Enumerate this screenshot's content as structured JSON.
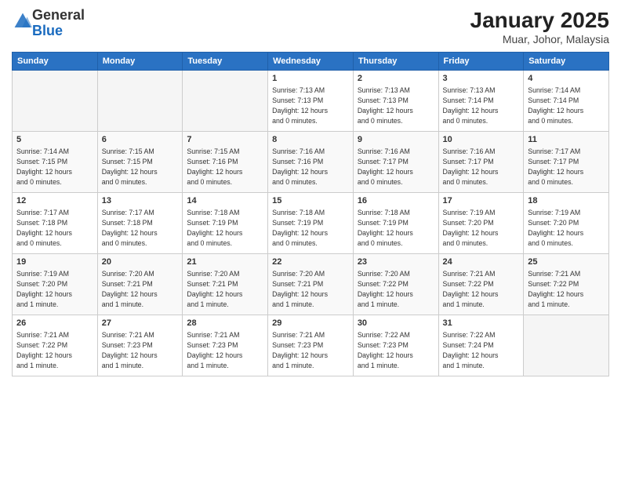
{
  "logo": {
    "general": "General",
    "blue": "Blue"
  },
  "header": {
    "title": "January 2025",
    "subtitle": "Muar, Johor, Malaysia"
  },
  "weekdays": [
    "Sunday",
    "Monday",
    "Tuesday",
    "Wednesday",
    "Thursday",
    "Friday",
    "Saturday"
  ],
  "weeks": [
    [
      {
        "day": "",
        "info": ""
      },
      {
        "day": "",
        "info": ""
      },
      {
        "day": "",
        "info": ""
      },
      {
        "day": "1",
        "info": "Sunrise: 7:13 AM\nSunset: 7:13 PM\nDaylight: 12 hours\nand 0 minutes."
      },
      {
        "day": "2",
        "info": "Sunrise: 7:13 AM\nSunset: 7:13 PM\nDaylight: 12 hours\nand 0 minutes."
      },
      {
        "day": "3",
        "info": "Sunrise: 7:13 AM\nSunset: 7:14 PM\nDaylight: 12 hours\nand 0 minutes."
      },
      {
        "day": "4",
        "info": "Sunrise: 7:14 AM\nSunset: 7:14 PM\nDaylight: 12 hours\nand 0 minutes."
      }
    ],
    [
      {
        "day": "5",
        "info": "Sunrise: 7:14 AM\nSunset: 7:15 PM\nDaylight: 12 hours\nand 0 minutes."
      },
      {
        "day": "6",
        "info": "Sunrise: 7:15 AM\nSunset: 7:15 PM\nDaylight: 12 hours\nand 0 minutes."
      },
      {
        "day": "7",
        "info": "Sunrise: 7:15 AM\nSunset: 7:16 PM\nDaylight: 12 hours\nand 0 minutes."
      },
      {
        "day": "8",
        "info": "Sunrise: 7:16 AM\nSunset: 7:16 PM\nDaylight: 12 hours\nand 0 minutes."
      },
      {
        "day": "9",
        "info": "Sunrise: 7:16 AM\nSunset: 7:17 PM\nDaylight: 12 hours\nand 0 minutes."
      },
      {
        "day": "10",
        "info": "Sunrise: 7:16 AM\nSunset: 7:17 PM\nDaylight: 12 hours\nand 0 minutes."
      },
      {
        "day": "11",
        "info": "Sunrise: 7:17 AM\nSunset: 7:17 PM\nDaylight: 12 hours\nand 0 minutes."
      }
    ],
    [
      {
        "day": "12",
        "info": "Sunrise: 7:17 AM\nSunset: 7:18 PM\nDaylight: 12 hours\nand 0 minutes."
      },
      {
        "day": "13",
        "info": "Sunrise: 7:17 AM\nSunset: 7:18 PM\nDaylight: 12 hours\nand 0 minutes."
      },
      {
        "day": "14",
        "info": "Sunrise: 7:18 AM\nSunset: 7:19 PM\nDaylight: 12 hours\nand 0 minutes."
      },
      {
        "day": "15",
        "info": "Sunrise: 7:18 AM\nSunset: 7:19 PM\nDaylight: 12 hours\nand 0 minutes."
      },
      {
        "day": "16",
        "info": "Sunrise: 7:18 AM\nSunset: 7:19 PM\nDaylight: 12 hours\nand 0 minutes."
      },
      {
        "day": "17",
        "info": "Sunrise: 7:19 AM\nSunset: 7:20 PM\nDaylight: 12 hours\nand 0 minutes."
      },
      {
        "day": "18",
        "info": "Sunrise: 7:19 AM\nSunset: 7:20 PM\nDaylight: 12 hours\nand 0 minutes."
      }
    ],
    [
      {
        "day": "19",
        "info": "Sunrise: 7:19 AM\nSunset: 7:20 PM\nDaylight: 12 hours\nand 1 minute."
      },
      {
        "day": "20",
        "info": "Sunrise: 7:20 AM\nSunset: 7:21 PM\nDaylight: 12 hours\nand 1 minute."
      },
      {
        "day": "21",
        "info": "Sunrise: 7:20 AM\nSunset: 7:21 PM\nDaylight: 12 hours\nand 1 minute."
      },
      {
        "day": "22",
        "info": "Sunrise: 7:20 AM\nSunset: 7:21 PM\nDaylight: 12 hours\nand 1 minute."
      },
      {
        "day": "23",
        "info": "Sunrise: 7:20 AM\nSunset: 7:22 PM\nDaylight: 12 hours\nand 1 minute."
      },
      {
        "day": "24",
        "info": "Sunrise: 7:21 AM\nSunset: 7:22 PM\nDaylight: 12 hours\nand 1 minute."
      },
      {
        "day": "25",
        "info": "Sunrise: 7:21 AM\nSunset: 7:22 PM\nDaylight: 12 hours\nand 1 minute."
      }
    ],
    [
      {
        "day": "26",
        "info": "Sunrise: 7:21 AM\nSunset: 7:22 PM\nDaylight: 12 hours\nand 1 minute."
      },
      {
        "day": "27",
        "info": "Sunrise: 7:21 AM\nSunset: 7:23 PM\nDaylight: 12 hours\nand 1 minute."
      },
      {
        "day": "28",
        "info": "Sunrise: 7:21 AM\nSunset: 7:23 PM\nDaylight: 12 hours\nand 1 minute."
      },
      {
        "day": "29",
        "info": "Sunrise: 7:21 AM\nSunset: 7:23 PM\nDaylight: 12 hours\nand 1 minute."
      },
      {
        "day": "30",
        "info": "Sunrise: 7:22 AM\nSunset: 7:23 PM\nDaylight: 12 hours\nand 1 minute."
      },
      {
        "day": "31",
        "info": "Sunrise: 7:22 AM\nSunset: 7:24 PM\nDaylight: 12 hours\nand 1 minute."
      },
      {
        "day": "",
        "info": ""
      }
    ]
  ]
}
